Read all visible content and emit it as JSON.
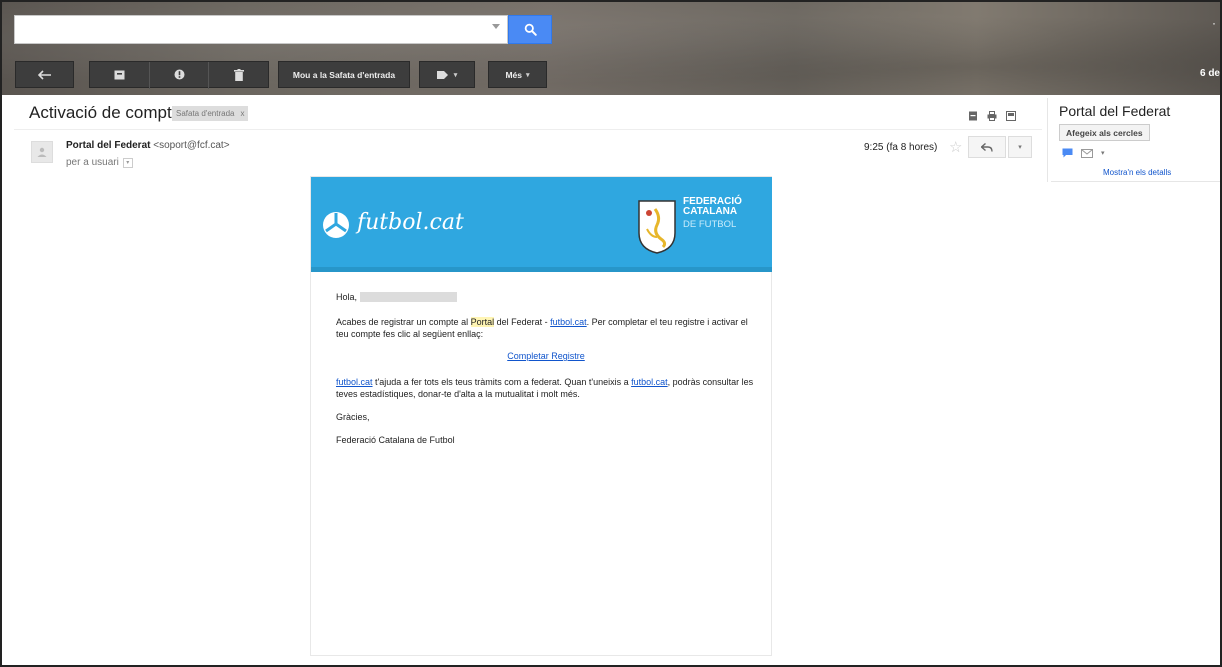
{
  "search": {
    "placeholder": "",
    "value": ""
  },
  "toolbar": {
    "move_to_inbox_label": "Mou a la Safata d'entrada",
    "more_label": "Més",
    "icons": [
      "back-arrow-icon",
      "archive-icon",
      "spam-icon",
      "trash-icon",
      "label-icon"
    ]
  },
  "top_right": {
    "text": "6 de",
    "dot": "·"
  },
  "email": {
    "subject": "Activació de compte",
    "label_chip": "Safata d'entrada",
    "label_close": "x",
    "sender_name": "Portal del Federat",
    "sender_email": "<soport@fcf.cat>",
    "recipient": "per a usuari",
    "time": "9:25 (fa 8 hores)",
    "star": "☆",
    "reply_icon": "reply-icon"
  },
  "side_panel": {
    "name": "Portal del Federat",
    "add_button": "Afegeix als cercles",
    "details_link": "Mostra'n els detalls"
  },
  "body": {
    "brand": "futbol.cat",
    "fed_line1": "FEDERACIÓ",
    "fed_line2": "CATALANA",
    "fed_line3": "DE FUTBOL",
    "greeting": "Hola,",
    "p1_a": "Acabes de registrar un compte al ",
    "p1_hl": "Portal",
    "p1_b": " del Federat - ",
    "p1_link": "futbol.cat",
    "p1_c": ". Per completar el teu registre i activar el teu compte fes clic al següent enllaç:",
    "cta": "Completar Registre",
    "p3_link1": "futbol.cat",
    "p3_a": " t'ajuda a fer tots els teus tràmits com a federat. Quan t'uneixis a ",
    "p3_link2": "futbol.cat",
    "p3_b": ", podràs consultar les teves estadístiques, donar-te d'alta a la mutualitat i molt més.",
    "thanks": "Gràcies,",
    "signature": "Federació Catalana de Futbol"
  },
  "colors": {
    "accent": "#4a8af4",
    "banner": "#2fa7e0",
    "link": "#1155cc"
  }
}
